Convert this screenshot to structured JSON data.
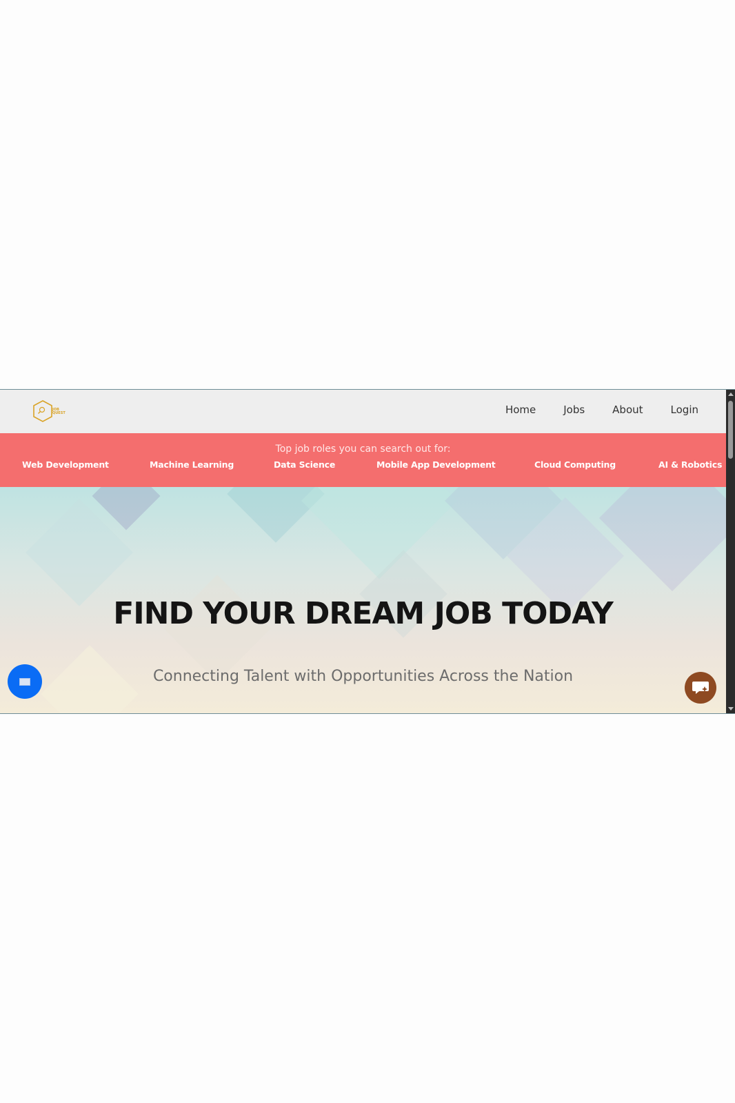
{
  "navbar": {
    "logo_text_line1": "JOB",
    "logo_text_line2": "QUEST",
    "links": [
      "Home",
      "Jobs",
      "About",
      "Login"
    ]
  },
  "roles_bar": {
    "title": "Top job roles you can search out for:",
    "roles": [
      "Web Development",
      "Machine Learning",
      "Data Science",
      "Mobile App Development",
      "Cloud Computing",
      "AI & Robotics"
    ]
  },
  "hero": {
    "title": "FIND YOUR DREAM JOB TODAY",
    "subtitle": "Connecting Talent with Opportunities Across the Nation"
  },
  "floating": {
    "left_icon": "envelope-icon",
    "right_icon": "chat-bubble-icon"
  },
  "colors": {
    "navbar_bg": "#eeeeee",
    "roles_bg": "#f46e6e",
    "logo_accent": "#d9a326",
    "chat_left_bg": "#0a6cf5",
    "chat_right_bg": "#8e4a22"
  }
}
